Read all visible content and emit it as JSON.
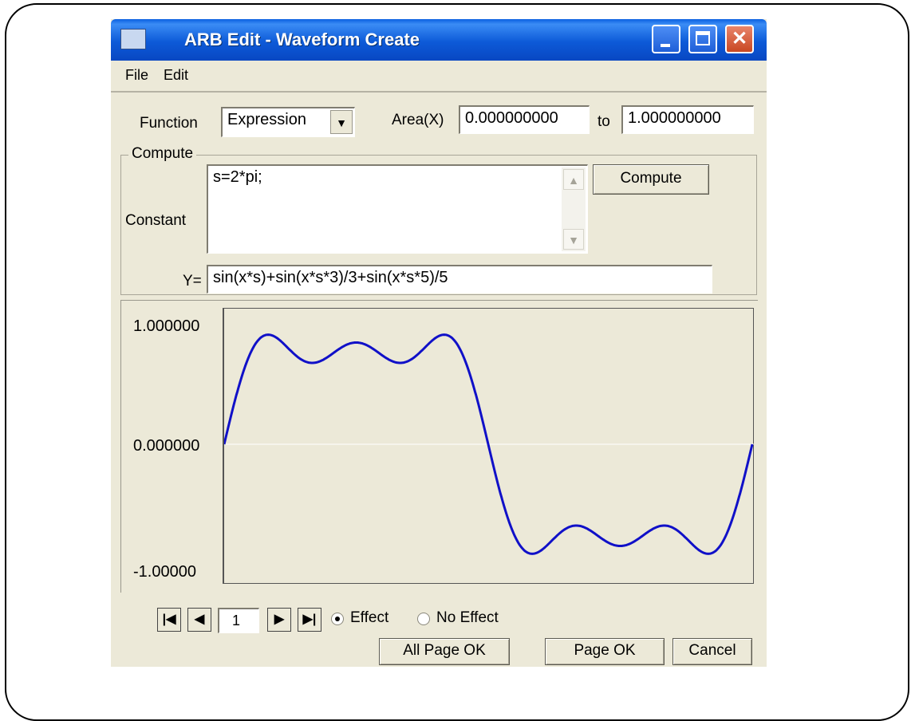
{
  "window": {
    "title": "ARB Edit - Waveform Create"
  },
  "menu": {
    "file": "File",
    "edit": "Edit"
  },
  "function": {
    "label": "Function",
    "value": "Expression"
  },
  "area": {
    "label": "Area(X)",
    "from": "0.000000000",
    "to_label": "to",
    "to": "1.000000000"
  },
  "compute": {
    "group_title": "Compute",
    "constant_label": "Constant",
    "constant_value": "s=2*pi;",
    "button": "Compute",
    "y_label": "Y=",
    "y_value": "sin(x*s)+sin(x*s*3)/3+sin(x*s*5)/5"
  },
  "chart_data": {
    "type": "line",
    "y_ticks": [
      "1.000000",
      "0.000000",
      "-1.00000"
    ],
    "ylim": [
      -1,
      1
    ],
    "xlim": [
      0,
      1
    ],
    "series": [
      {
        "expression": "sin(x*s)+sin(x*s*3)/3+sin(x*s*5)/5",
        "color": "#1010c8"
      }
    ]
  },
  "navigation": {
    "page": "1"
  },
  "options": {
    "effect": "Effect",
    "no_effect": "No Effect",
    "selected": "Effect"
  },
  "buttons": {
    "all_page_ok": "All Page OK",
    "page_ok": "Page OK",
    "cancel": "Cancel"
  }
}
